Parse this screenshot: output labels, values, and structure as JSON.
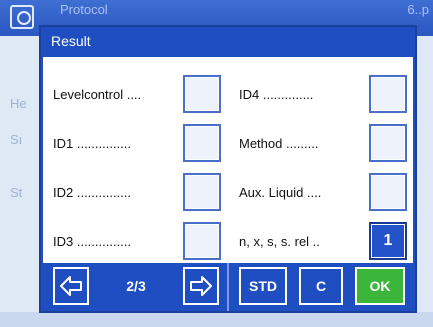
{
  "background": {
    "title": "Protocol",
    "title_right": "6..p",
    "side_labels": [
      "He",
      "Sı",
      "St"
    ]
  },
  "dialog": {
    "title": "Result",
    "left_column": [
      {
        "label": "Levelcontrol ....",
        "value": ""
      },
      {
        "label": "ID1 ...............",
        "value": ""
      },
      {
        "label": "ID2 ...............",
        "value": ""
      },
      {
        "label": "ID3 ...............",
        "value": ""
      }
    ],
    "right_column": [
      {
        "label": "ID4 ..............",
        "value": ""
      },
      {
        "label": "Method .........",
        "value": ""
      },
      {
        "label": "Aux. Liquid ....",
        "value": ""
      },
      {
        "label": "n, x, s, s. rel ..",
        "value": "1"
      }
    ]
  },
  "footer": {
    "page_indicator": "2/3",
    "std_label": "STD",
    "c_label": "C",
    "ok_label": "OK"
  },
  "colors": {
    "dialog_blue": "#1f4ec2",
    "ok_green": "#3bb63b",
    "active_cell": "#2452c9"
  },
  "icons": {
    "prev": "arrow-left-icon",
    "next": "arrow-right-icon"
  }
}
